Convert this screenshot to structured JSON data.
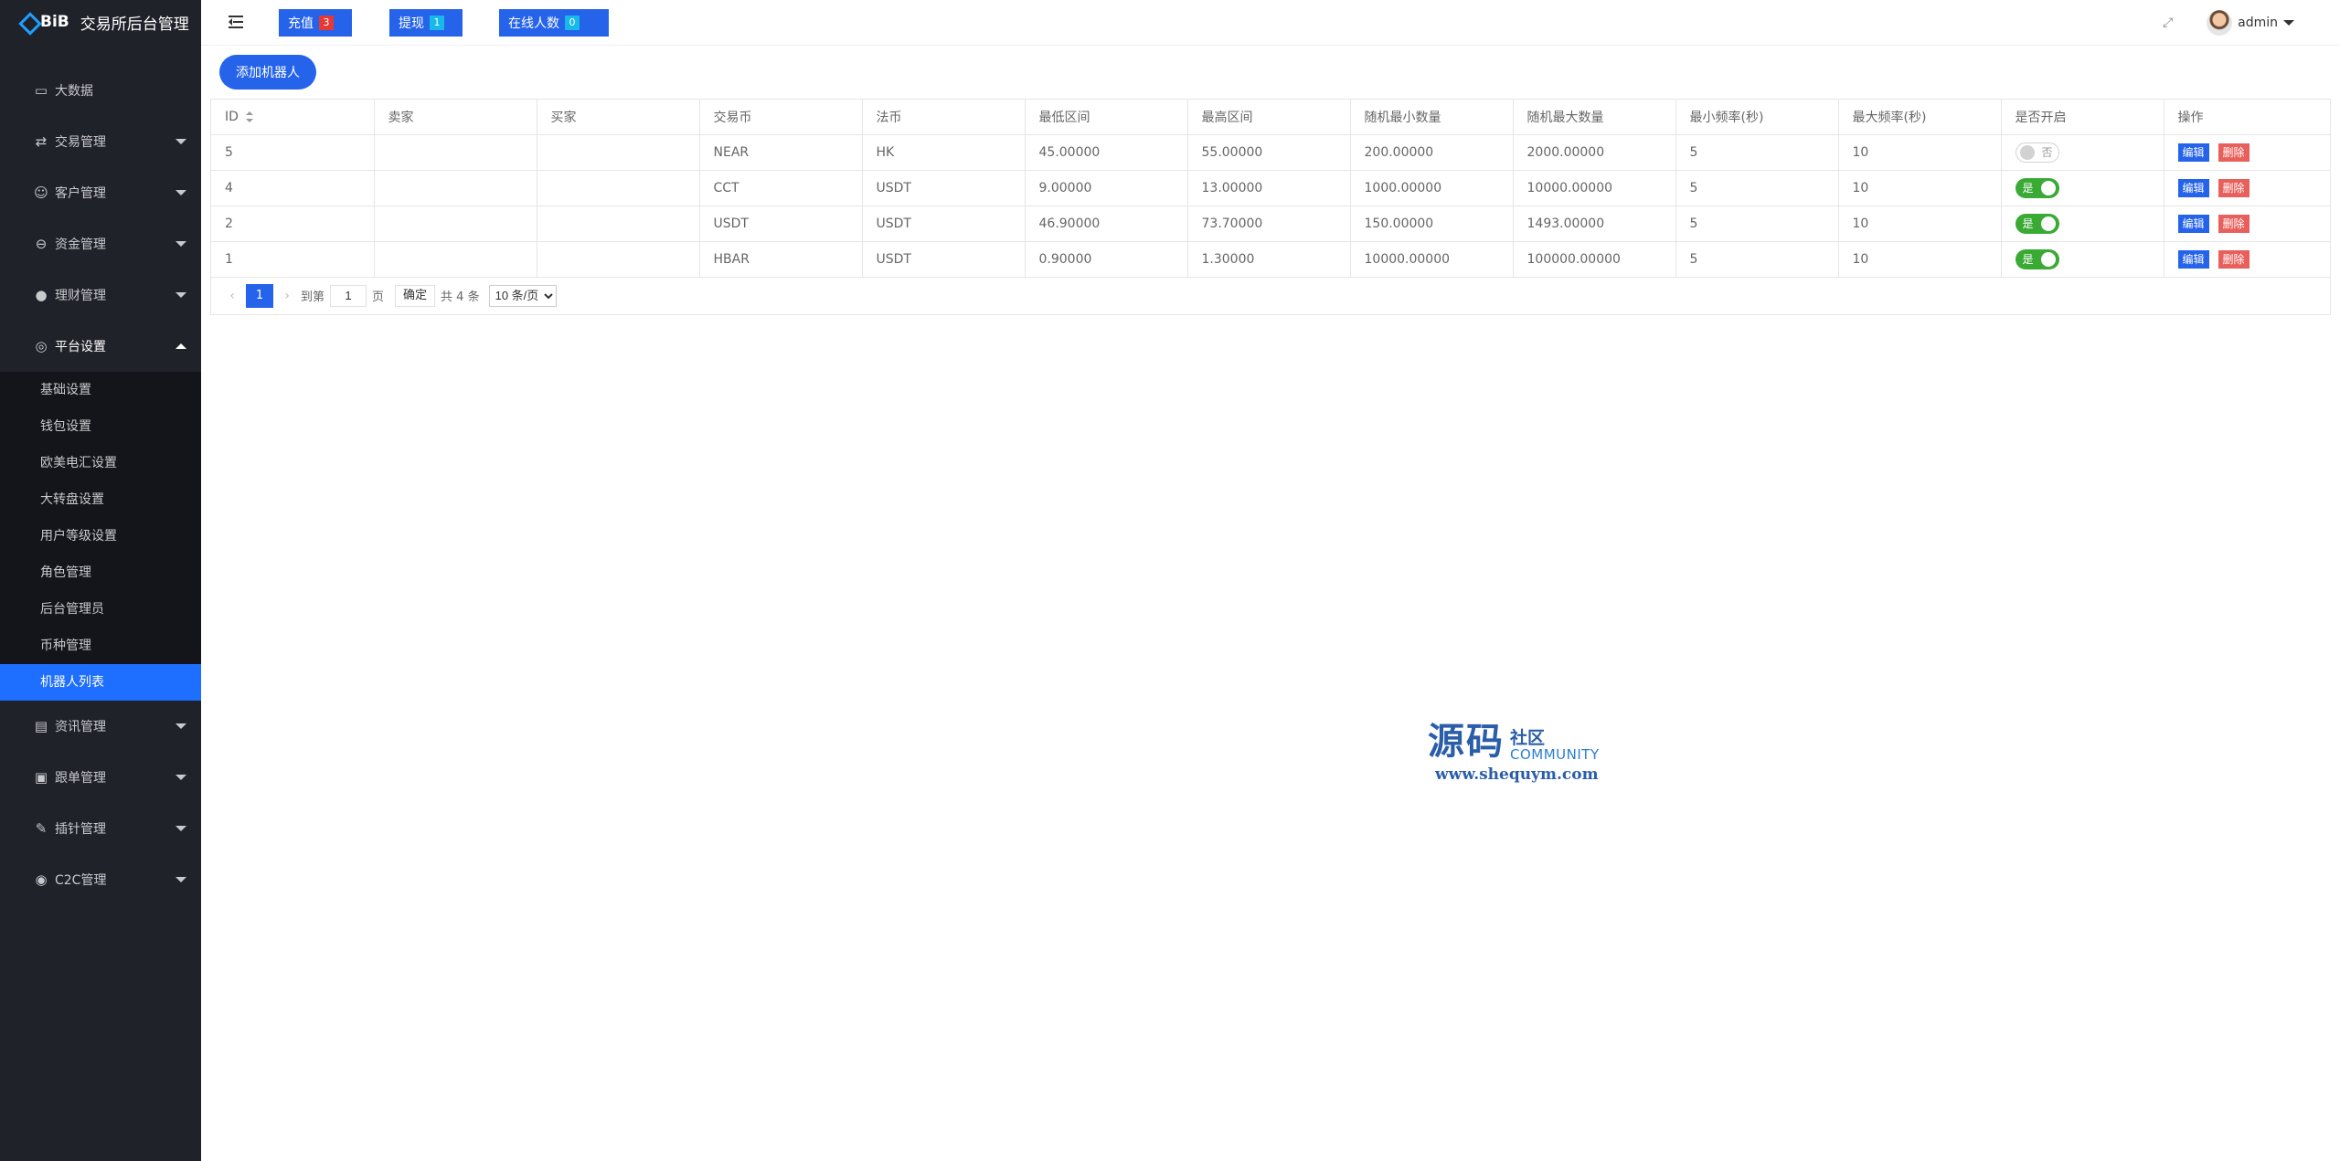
{
  "app": {
    "logo_text": "BiB",
    "title": "交易所后台管理"
  },
  "sidebar": {
    "items": [
      {
        "label": "大数据",
        "icon": "monitor-icon"
      },
      {
        "label": "交易管理",
        "icon": "exchange-icon"
      },
      {
        "label": "客户管理",
        "icon": "users-icon"
      },
      {
        "label": "资金管理",
        "icon": "wallet-icon"
      },
      {
        "label": "理财管理",
        "icon": "piggy-bank-icon"
      },
      {
        "label": "平台设置",
        "icon": "settings-icon"
      }
    ],
    "sub_items": [
      "基础设置",
      "钱包设置",
      "欧美电汇设置",
      "大转盘设置",
      "用户等级设置",
      "角色管理",
      "后台管理员",
      "币种管理",
      "机器人列表"
    ],
    "bottom_items": [
      {
        "label": "资讯管理",
        "icon": "news-icon"
      },
      {
        "label": "跟单管理",
        "icon": "copy-icon"
      },
      {
        "label": "插针管理",
        "icon": "pin-icon"
      },
      {
        "label": "C2C管理",
        "icon": "c2c-icon"
      }
    ]
  },
  "topbar": {
    "recharge_label": "充值",
    "recharge_count": "3",
    "withdraw_label": "提现",
    "withdraw_count": "1",
    "online_label": "在线人数",
    "online_count": "0",
    "username": "admin"
  },
  "main": {
    "add_button": "添加机器人",
    "columns": [
      "ID",
      "卖家",
      "买家",
      "交易币",
      "法币",
      "最低区间",
      "最高区间",
      "随机最小数量",
      "随机最大数量",
      "最小频率(秒)",
      "最大频率(秒)",
      "是否开启",
      "操作"
    ],
    "rows": [
      {
        "id": "5",
        "seller": "",
        "buyer": "",
        "coin": "NEAR",
        "fiat": "HK",
        "min": "45.00000",
        "max": "55.00000",
        "rand_min": "200.00000",
        "rand_max": "2000.00000",
        "freq_min": "5",
        "freq_max": "10",
        "enabled": false,
        "switch_text": "否"
      },
      {
        "id": "4",
        "seller": "",
        "buyer": "",
        "coin": "CCT",
        "fiat": "USDT",
        "min": "9.00000",
        "max": "13.00000",
        "rand_min": "1000.00000",
        "rand_max": "10000.00000",
        "freq_min": "5",
        "freq_max": "10",
        "enabled": true,
        "switch_text": "是"
      },
      {
        "id": "2",
        "seller": "",
        "buyer": "",
        "coin": "USDT",
        "fiat": "USDT",
        "min": "46.90000",
        "max": "73.70000",
        "rand_min": "150.00000",
        "rand_max": "1493.00000",
        "freq_min": "5",
        "freq_max": "10",
        "enabled": true,
        "switch_text": "是"
      },
      {
        "id": "1",
        "seller": "",
        "buyer": "",
        "coin": "HBAR",
        "fiat": "USDT",
        "min": "0.90000",
        "max": "1.30000",
        "rand_min": "10000.00000",
        "rand_max": "100000.00000",
        "freq_min": "5",
        "freq_max": "10",
        "enabled": true,
        "switch_text": "是"
      }
    ],
    "edit_label": "编辑",
    "delete_label": "删除"
  },
  "pager": {
    "current_page": "1",
    "goto_label": "到第",
    "page_input": "1",
    "page_label": "页",
    "ok_label": "确定",
    "total_label": "共 4 条",
    "page_size": "10 条/页"
  },
  "watermark": {
    "big": "源码",
    "small": "社区",
    "community": "COMMUNITY",
    "url": "www.shequym.com"
  },
  "colors": {
    "sidebar_bg": "#20222a",
    "accent": "#2563eb",
    "active_menu": "#1e6fff",
    "switch_on": "#3aaa35",
    "delete": "#e8605c"
  }
}
